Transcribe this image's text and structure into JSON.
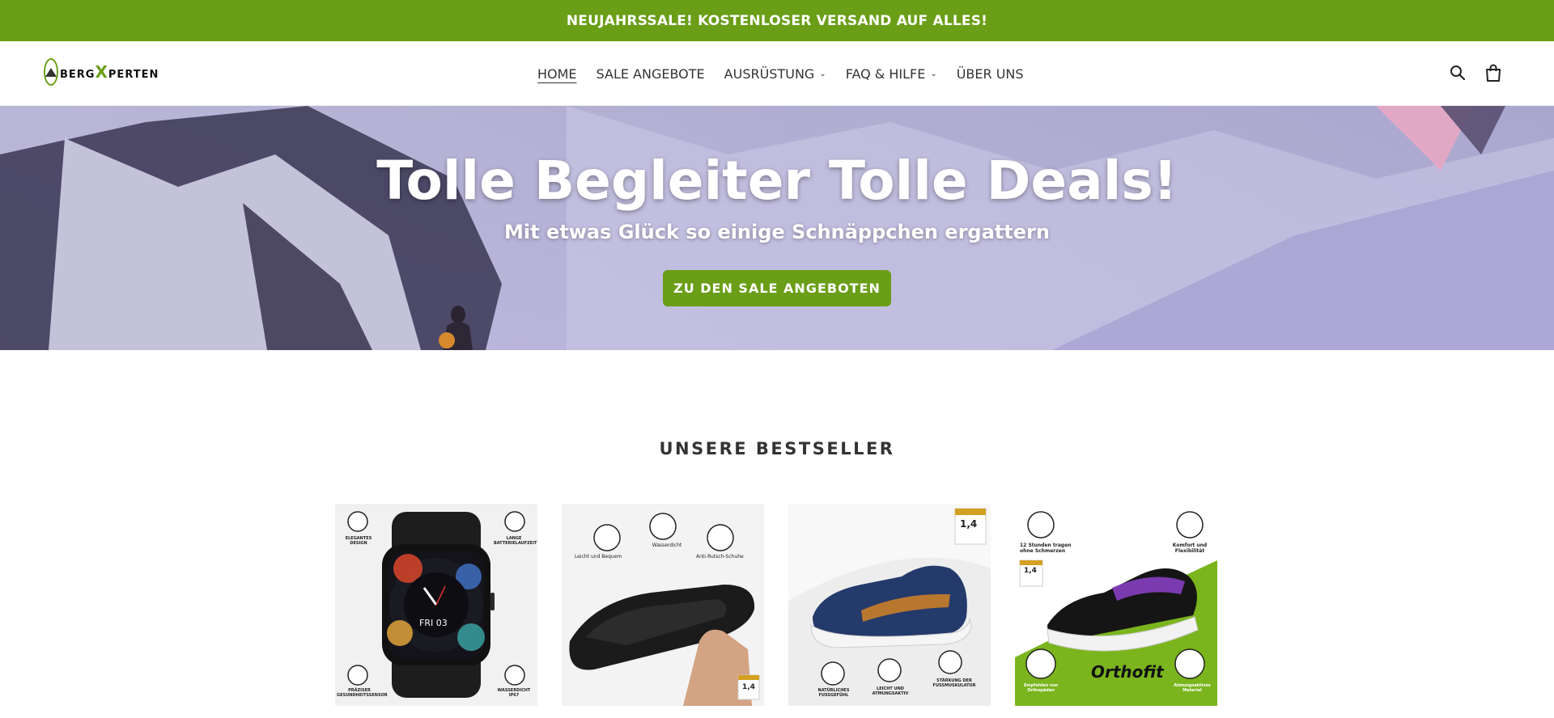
{
  "announcement": {
    "text": "NEUJAHRSSALE! KOSTENLOSER VERSAND AUF ALLES!"
  },
  "logo": {
    "pre": "BERG",
    "x": "X",
    "post": "PERTEN"
  },
  "nav": [
    {
      "label": "HOME",
      "dropdown": false,
      "active": true
    },
    {
      "label": "SALE ANGEBOTE",
      "dropdown": false,
      "active": false
    },
    {
      "label": "AUSRÜSTUNG",
      "dropdown": true,
      "active": false
    },
    {
      "label": "FAQ & HILFE",
      "dropdown": true,
      "active": false
    },
    {
      "label": "ÜBER UNS",
      "dropdown": false,
      "active": false
    }
  ],
  "header_icons": [
    "search-icon",
    "cart-icon"
  ],
  "hero": {
    "title": "Tolle Begleiter Tolle Deals!",
    "subtitle": "Mit etwas Glück so einige Schnäppchen ergattern",
    "cta": "ZU DEN SALE ANGEBOTEN"
  },
  "bestsellers": {
    "title": "UNSERE BESTSELLER",
    "products": [
      {
        "image": "smartwatch",
        "labels": [
          "ELEGANTES DESIGN",
          "LANGE BATTERIELAUFZEIT",
          "PRÄZISER GESUNDHEITSSENSOR",
          "WASSERDICHT IP67"
        ],
        "screen": "FRI 03"
      },
      {
        "image": "slides",
        "labels": [
          "Leicht und Bequem",
          "Wasserdicht",
          "Anti-Rutsch-Schuhe"
        ],
        "badge": "1,4"
      },
      {
        "image": "sneaker-blue",
        "labels": [
          "NATÜRLICHES FUSSGEFÜHL",
          "LEICHT UND ATMUNGSAKTIV",
          "STÄRKUNG DER FUSSMUSKULATUR"
        ],
        "badge": "1,4"
      },
      {
        "image": "orthofit-shoe",
        "labels": [
          "12 Stunden tragen ohne Schmerzen",
          "Komfort und Flexibilität",
          "Empfohlen von Orthopäden",
          "Atmungsaktives Material"
        ],
        "brand": "Orthofit",
        "badge": "1,4"
      }
    ]
  },
  "colors": {
    "brand_green": "#6a9e17",
    "text_dark": "#333333"
  }
}
